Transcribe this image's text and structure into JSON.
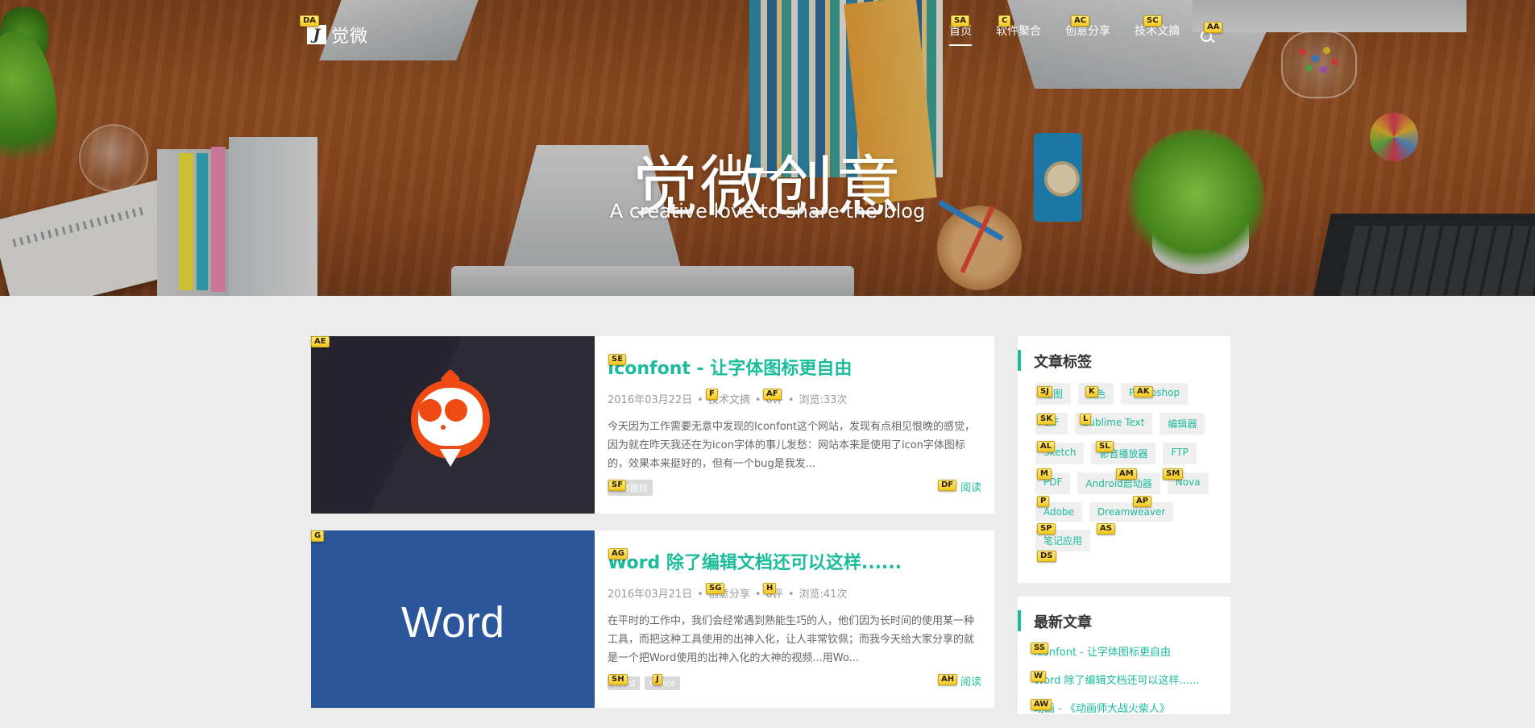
{
  "site": {
    "logo_letter": "J",
    "logo_text": "觉微",
    "nav": [
      "首页",
      "软件聚合",
      "创意分享",
      "技术文摘"
    ],
    "hero_title": "觉微创意",
    "hero_subtitle": "A creative love to share the blog"
  },
  "articles": [
    {
      "title": "Iconfont - 让字体图标更自由",
      "date": "2016年03月22日",
      "category": "技术文摘",
      "comments": "0评",
      "views": "浏览:33次",
      "excerpt": "今天因为工作需要无意中发现的Iconfont这个网站，发现有点相见恨晚的感觉，因为就在昨天我还在为icon字体的事儿发愁：网站本来是使用了icon字体图标的，效果本来挺好的，但有一个bug是我发...",
      "tags": [
        "字体图标"
      ],
      "more": "阅读"
    },
    {
      "title": "Word 除了编辑文档还可以这样......",
      "date": "2016年03月21日",
      "category": "创意分享",
      "comments": "0评",
      "views": "浏览:41次",
      "excerpt": "在平时的工作中，我们会经常遇到熟能生巧的人，他们因为长时间的使用某一种工具，而把这种工具使用的出神入化，让人非常钦佩；而我今天给大家分享的就是一个把Word使用的出神入化的大神的视频...用Wo...",
      "thumb_text": "Word",
      "tags": [
        "Word",
        "Office"
      ],
      "more": "阅读"
    }
  ],
  "sidebar": {
    "tags_title": "文章标签",
    "tags": [
      "截图",
      "取色",
      "Photoshop",
      "GIF",
      "Sublime Text",
      "编辑器",
      "Sketch",
      "影音播放器",
      "FTP",
      "PDF",
      "Android启动器",
      "Nova",
      "Adobe",
      "Dreamweaver",
      "笔记应用"
    ],
    "recent_title": "最新文章",
    "recent": [
      "Iconfont - 让字体图标更自由",
      "Word 除了编辑文档还可以这样......",
      "动画 - 《动画师大战火柴人》"
    ]
  },
  "hints": {
    "logo": "DA",
    "nav0": "SA",
    "nav1": "C",
    "nav2": "AC",
    "nav3": "SC",
    "search": "AA",
    "a1_thumb": "AE",
    "a1_title": "SE",
    "a1_cat": "F",
    "a1_comments": "AF",
    "a1_tag0": "SF",
    "a1_more": "DF",
    "a2_thumb": "G",
    "a2_title": "AG",
    "a2_cat": "SG",
    "a2_comments": "H",
    "a2_tag0": "SH",
    "a2_tag1": "J",
    "a2_more": "AH",
    "tag0": "SJ",
    "tag1": "K",
    "tag2": "AK",
    "tag3": "SK",
    "tag4": "L",
    "tag5": "AL",
    "tag6": "SL",
    "tag7": "M",
    "tag8": "AM",
    "tag9": "SM",
    "tag10": "P",
    "tag11": "AP",
    "tag12": "SP",
    "tag13": "AS",
    "tag14": "DS",
    "recent0": "SS",
    "recent1": "W",
    "recent2": "AW"
  }
}
